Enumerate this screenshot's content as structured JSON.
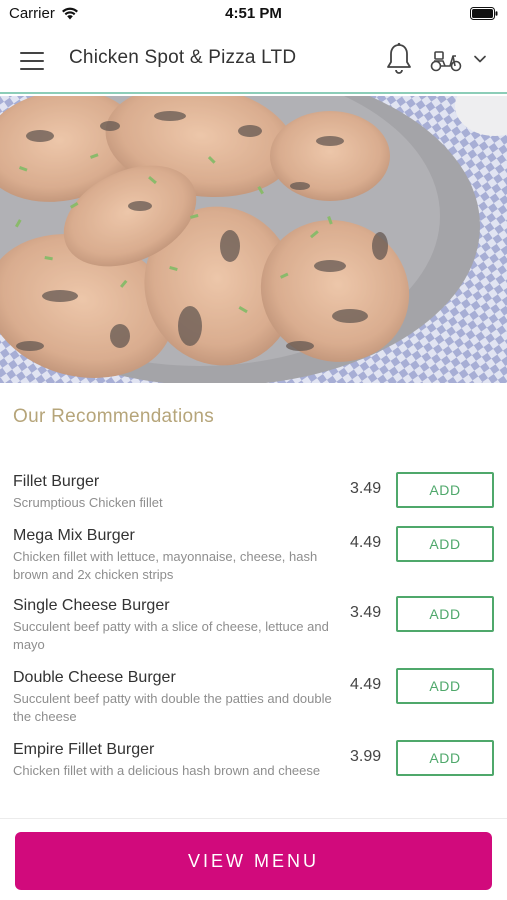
{
  "status_bar": {
    "carrier": "Carrier",
    "time": "4:51 PM"
  },
  "header": {
    "title": "Chicken Spot & Pizza LTD",
    "icons": [
      "hamburger-menu-icon",
      "bell-icon",
      "scooter-icon",
      "chevron-down-icon"
    ]
  },
  "hero": {
    "image": "grilled-chicken-wings-photo"
  },
  "recommendations": {
    "title": "Our Recommendations",
    "items": [
      {
        "name": "Fillet Burger",
        "desc": "Scrumptious Chicken fillet",
        "price": "3.49",
        "add_label": "ADD"
      },
      {
        "name": "Mega Mix Burger",
        "desc": "Chicken fillet with lettuce, mayonnaise, cheese, hash brown and 2x chicken strips",
        "price": "4.49",
        "add_label": "ADD"
      },
      {
        "name": "Single Cheese Burger",
        "desc": "Succulent beef patty with a slice of cheese, lettuce and mayo",
        "price": "3.49",
        "add_label": "ADD"
      },
      {
        "name": "Double Cheese Burger",
        "desc": "Succulent beef patty with double the patties and double the cheese",
        "price": "4.49",
        "add_label": "ADD"
      },
      {
        "name": "Empire Fillet Burger",
        "desc": "Chicken fillet with a delicious hash brown and cheese",
        "price": "3.99",
        "add_label": "ADD"
      }
    ]
  },
  "footer": {
    "view_menu_label": "VIEW MENU"
  },
  "colors": {
    "accent": "#d10a7c",
    "add_green": "#4fa86b",
    "section_title": "#b6a57a",
    "header_border": "#8ccdb8"
  }
}
